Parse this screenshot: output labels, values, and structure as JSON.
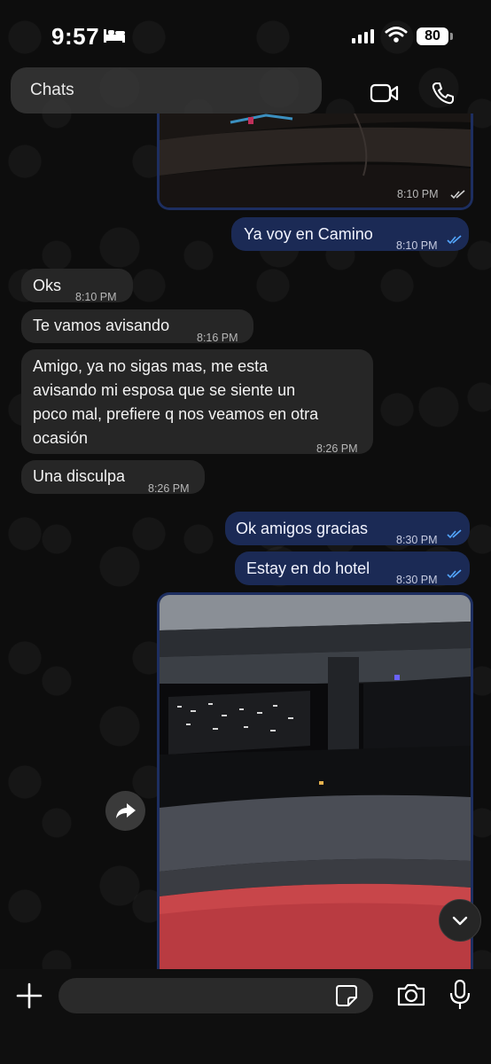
{
  "status_bar": {
    "time": "9:57",
    "battery": "80"
  },
  "header": {
    "back_label": "Chats"
  },
  "messages": [
    {
      "id": "m1",
      "dir": "out",
      "type": "image",
      "time": "8:10 PM"
    },
    {
      "id": "m2",
      "dir": "out",
      "text": "Ya voy en Camino",
      "time": "8:10 PM"
    },
    {
      "id": "m3",
      "dir": "in",
      "text": "Oks",
      "time": "8:10 PM"
    },
    {
      "id": "m4",
      "dir": "in",
      "text": "Te vamos avisando",
      "time": "8:16 PM"
    },
    {
      "id": "m5",
      "dir": "in",
      "lines": [
        "Amigo, ya no sigas mas, me esta",
        "avisando mi esposa que se siente un",
        "poco mal, prefiere q nos veamos en otra",
        "ocasión"
      ],
      "time": "8:26 PM"
    },
    {
      "id": "m6",
      "dir": "in",
      "text": "Una disculpa",
      "time": "8:26 PM"
    },
    {
      "id": "m7",
      "dir": "out",
      "text": "Ok amigos gracias",
      "time": "8:30 PM"
    },
    {
      "id": "m8",
      "dir": "out",
      "text": "Estay en do hotel",
      "time": "8:30 PM"
    },
    {
      "id": "m9",
      "dir": "out",
      "type": "image"
    }
  ],
  "icons": {
    "status": [
      "bed-icon",
      "signal-icon",
      "wifi-icon",
      "battery-icon"
    ],
    "header": [
      "video-call-icon",
      "phone-call-icon"
    ],
    "chat": [
      "forward-icon",
      "chevron-down-icon"
    ],
    "input": [
      "plus-icon",
      "sticker-icon",
      "camera-icon",
      "microphone-icon"
    ]
  },
  "colors": {
    "outgoing_bubble": "#1b2a55",
    "incoming_bubble": "#262626",
    "read_ticks": "#53a6ff"
  }
}
